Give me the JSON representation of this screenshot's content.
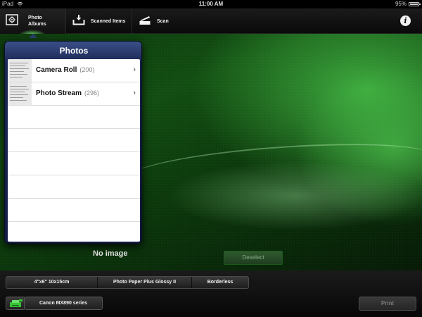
{
  "status_bar": {
    "carrier": "iPad",
    "time": "11:00 AM",
    "battery": "95%"
  },
  "toolbar": {
    "tabs": [
      {
        "label": "Photo Albums",
        "icon": "photo-albums-icon",
        "selected": true
      },
      {
        "label": "Scanned Items",
        "icon": "scanned-items-icon"
      },
      {
        "label": "Scan",
        "icon": "scan-icon"
      }
    ],
    "info_icon": "info-icon"
  },
  "popover": {
    "title": "Photos",
    "items": [
      {
        "label": "Camera Roll",
        "count": "(200)"
      },
      {
        "label": "Photo Stream",
        "count": "(296)"
      }
    ]
  },
  "main": {
    "no_image_text": "No image",
    "deselect_label": "Deselect"
  },
  "print_settings": {
    "paper_size": "4\"x6\" 10x15cm",
    "media_type": "Photo Paper Plus Glossy II",
    "layout": "Borderless"
  },
  "printer": {
    "name": "Canon MX890 series",
    "print_label": "Print"
  },
  "colors": {
    "accent_green": "#2fa82f",
    "popover_header": "#1a2654"
  }
}
